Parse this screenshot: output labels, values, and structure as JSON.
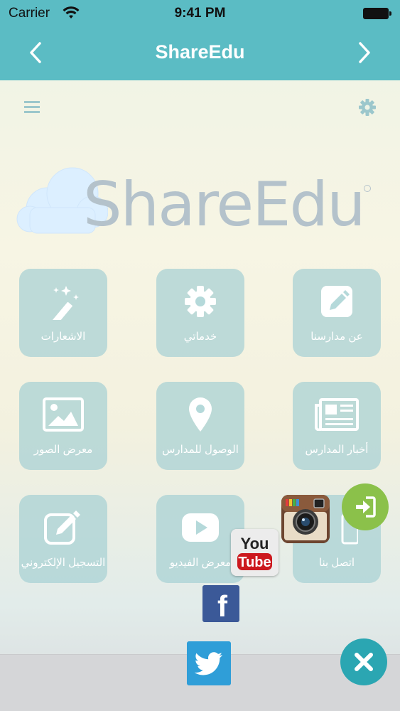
{
  "status_bar": {
    "carrier": "Carrier",
    "time": "9:41 PM"
  },
  "nav": {
    "title": "ShareEdu",
    "back_icon": "chevron-left-icon",
    "forward_icon": "chevron-right-icon"
  },
  "toolbar": {
    "menu_icon": "hamburger-menu-icon",
    "settings_icon": "gear-icon"
  },
  "logo": {
    "text": "ShareEdu"
  },
  "tiles": [
    {
      "label": "الاشعارات",
      "icon": "magic-wand-icon"
    },
    {
      "label": "خدماتي",
      "icon": "gear-icon"
    },
    {
      "label": "عن مدارسنا",
      "icon": "edit-icon"
    },
    {
      "label": "معرض الصور",
      "icon": "image-icon"
    },
    {
      "label": "الوصول للمدارس",
      "icon": "map-pin-icon"
    },
    {
      "label": "أخبار المدارس",
      "icon": "newspaper-icon"
    },
    {
      "label": "التسجيل الإلكتروني",
      "icon": "form-edit-icon"
    },
    {
      "label": "معرض الفيديو",
      "icon": "play-icon"
    },
    {
      "label": "اتصل بنا",
      "icon": "phone-icon"
    }
  ],
  "social": {
    "youtube": {
      "line1": "You",
      "line2": "Tube"
    },
    "facebook": {
      "glyph": "f"
    },
    "twitter_icon": "twitter-bird-icon",
    "instagram_icon": "instagram-camera-icon"
  },
  "colors": {
    "nav": "#5bbcc4",
    "tile": "#aad2d4",
    "login": "#8bc14a",
    "close": "#2ba6b2",
    "facebook": "#3b5998",
    "twitter": "#2f9ed8"
  }
}
